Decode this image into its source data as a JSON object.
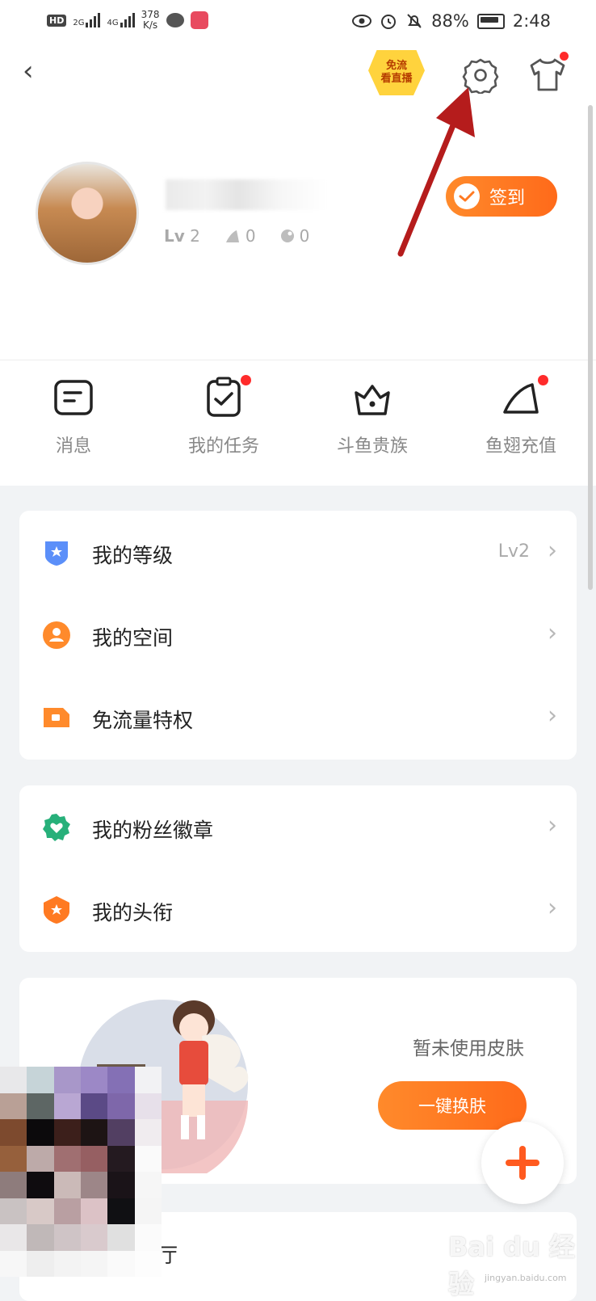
{
  "status_bar": {
    "hd": "HD",
    "net1": "2G",
    "net2": "4G",
    "speed_value": "378",
    "speed_unit": "K/s",
    "battery": "88%",
    "time": "2:48"
  },
  "header": {
    "back": "‹",
    "free_badge_line1": "免流",
    "free_badge_line2": "看直播"
  },
  "profile": {
    "level": "Lv",
    "level_value": "2",
    "fins": "0",
    "balls": "0",
    "signin_label": "签到"
  },
  "quick_actions": [
    {
      "label": "消息",
      "icon": "message-icon",
      "dot": false
    },
    {
      "label": "我的任务",
      "icon": "task-clipboard-icon",
      "dot": true
    },
    {
      "label": "斗鱼贵族",
      "icon": "crown-icon",
      "dot": false
    },
    {
      "label": "鱼翅充值",
      "icon": "fin-icon",
      "dot": true
    }
  ],
  "menu_group1": [
    {
      "label": "我的等级",
      "value": "Lv2",
      "icon": "level-shield-icon"
    },
    {
      "label": "我的空间",
      "value": "",
      "icon": "space-user-icon"
    },
    {
      "label": "免流量特权",
      "value": "",
      "icon": "free-data-icon"
    }
  ],
  "menu_group2": [
    {
      "label": "我的粉丝徽章",
      "value": "",
      "icon": "fan-badge-icon"
    },
    {
      "label": "我的头衔",
      "value": "",
      "icon": "title-medal-icon"
    }
  ],
  "skin": {
    "empty_text": "暂未使用皮肤",
    "button": "一键换肤"
  },
  "lobby": {
    "label": "大厅"
  },
  "watermark": {
    "main": "Bai du 经验",
    "sub": "jingyan.baidu.com"
  },
  "colors": {
    "accent": "#ff7a22",
    "red_dot": "#ff2b2b",
    "arrow": "#b51c1c"
  }
}
